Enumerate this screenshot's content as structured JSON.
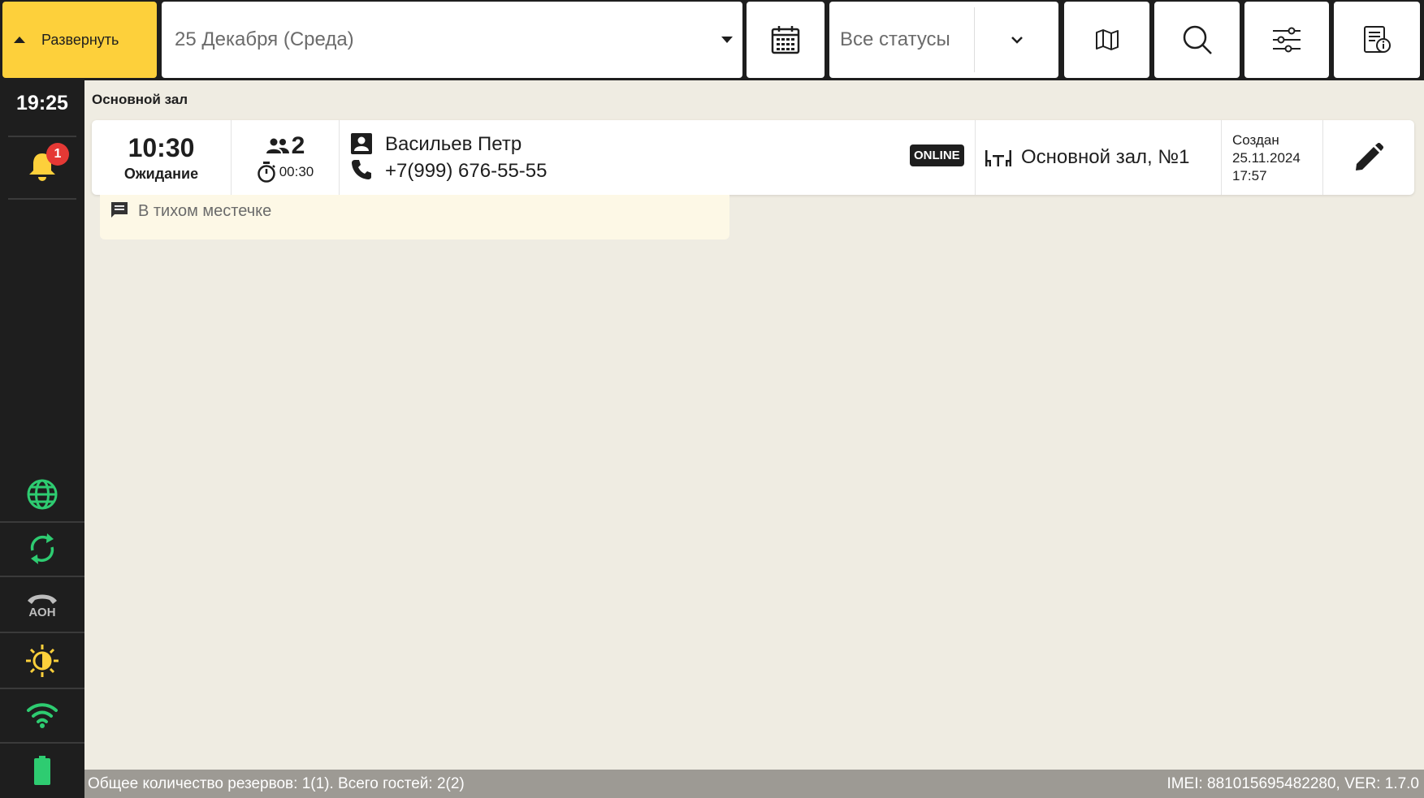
{
  "toolbar": {
    "expand_label": "Развернуть",
    "date_value": "25 Декабря (Среда)",
    "status_value": "Все статусы",
    "icons": [
      "calendar-icon",
      "map-icon",
      "search-icon",
      "filter-sliders-icon",
      "report-info-icon"
    ]
  },
  "sidebar": {
    "clock": "19:25",
    "notifications_count": "1",
    "aon_label": "АОН",
    "icons": [
      "bell-icon",
      "globe-icon",
      "sync-icon",
      "phone-aon-icon",
      "brightness-icon",
      "wifi-icon",
      "battery-icon"
    ]
  },
  "main": {
    "hall_title": "Основной зал",
    "reservation": {
      "time": "10:30",
      "status": "Ожидание",
      "guests": "2",
      "duration": "00:30",
      "guest_name": "Васильев Петр",
      "phone": "+7(999) 676-55-55",
      "source_badge": "ONLINE",
      "table": "Основной зал, №1",
      "created_label": "Создан",
      "created_date": "25.11.2024",
      "created_time": "17:57",
      "comment": "В тихом местечке"
    }
  },
  "statusbar": {
    "summary": "Общее количество резервов: 1(1). Всего гостей: 2(2)",
    "device": "IMEI: 881015695482280, VER: 1.7.0"
  },
  "colors": {
    "accent_yellow": "#fdd03b",
    "dark": "#1e1e1e",
    "main_bg": "#efece2",
    "green_icon": "#2ecc71",
    "badge_red": "#e53935"
  }
}
